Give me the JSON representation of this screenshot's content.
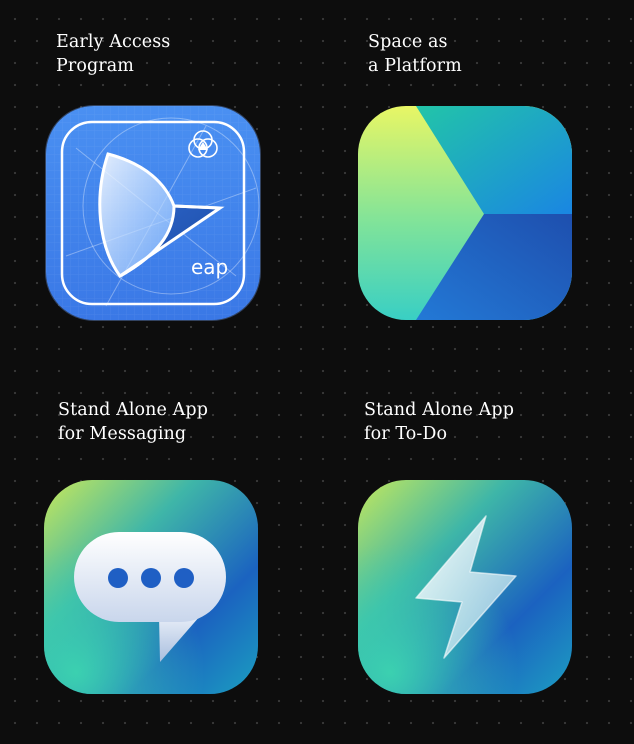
{
  "apps": [
    {
      "id": "eap",
      "caption_line1": "Early Access",
      "caption_line2": "Program",
      "icon_name": "compass-blueprint-icon",
      "badge_text": "eap",
      "colors": {
        "base": "#3f86ee",
        "light": "#5a9ef5",
        "line": "#ffffff"
      }
    },
    {
      "id": "space",
      "caption_line1": "Space as",
      "caption_line2": "a Platform",
      "icon_name": "play-triangle-gradient-icon",
      "colors": {
        "yellow": "#e6f564",
        "teal": "#2ec3b2",
        "blue": "#1e74d8",
        "navy": "#1b4fa8"
      }
    },
    {
      "id": "messaging",
      "caption_line1": "Stand Alone App",
      "caption_line2": "for Messaging",
      "icon_name": "chat-bubble-icon",
      "colors": {
        "dots": "#1f5fc4",
        "bubble": "#f2f5fb"
      }
    },
    {
      "id": "todo",
      "caption_line1": "Stand Alone App",
      "caption_line2": "for To-Do",
      "icon_name": "lightning-bolt-icon",
      "colors": {
        "bolt": "#eef6fb"
      }
    }
  ]
}
